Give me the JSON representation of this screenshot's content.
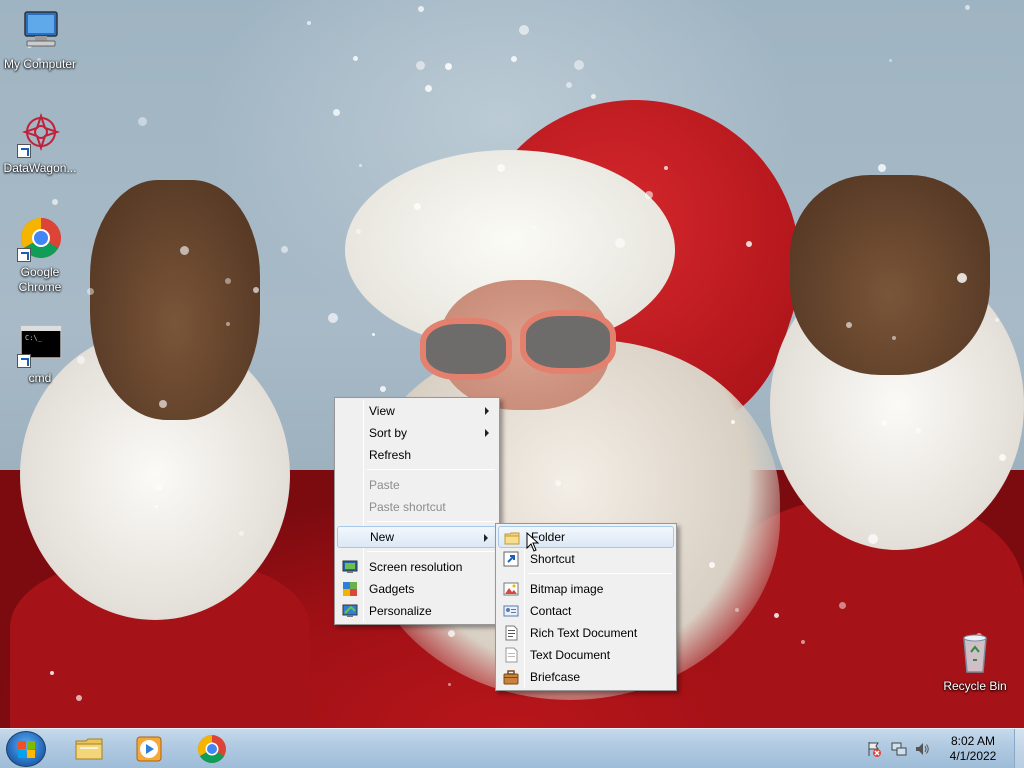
{
  "desktop_icons": [
    {
      "label": "My Computer",
      "icon": "computer-icon"
    },
    {
      "label": "DataWagon...",
      "icon": "datawagon-icon"
    },
    {
      "label": "Google Chrome",
      "icon": "chrome-icon"
    },
    {
      "label": "cmd",
      "icon": "cmd-icon"
    },
    {
      "label": "Recycle Bin",
      "icon": "recycle-bin-icon"
    }
  ],
  "context_menu": {
    "items": [
      {
        "label": "View",
        "submenu": true
      },
      {
        "label": "Sort by",
        "submenu": true
      },
      {
        "label": "Refresh"
      },
      {
        "label": "Paste",
        "disabled": true
      },
      {
        "label": "Paste shortcut",
        "disabled": true
      },
      {
        "label": "New",
        "submenu": true
      },
      {
        "label": "Screen resolution",
        "icon": "screen-resolution-icon"
      },
      {
        "label": "Gadgets",
        "icon": "gadgets-icon"
      },
      {
        "label": "Personalize",
        "icon": "personalize-icon"
      }
    ]
  },
  "new_submenu": {
    "items": [
      {
        "label": "Folder",
        "icon": "folder-icon"
      },
      {
        "label": "Shortcut",
        "icon": "shortcut-icon"
      },
      {
        "label": "Bitmap image",
        "icon": "bitmap-icon"
      },
      {
        "label": "Contact",
        "icon": "contact-icon"
      },
      {
        "label": "Rich Text Document",
        "icon": "rich-text-icon"
      },
      {
        "label": "Text Document",
        "icon": "text-document-icon"
      },
      {
        "label": "Briefcase",
        "icon": "briefcase-icon"
      }
    ]
  },
  "taskbar": {
    "pinned": [
      "file-explorer-icon",
      "media-player-icon",
      "chrome-icon"
    ],
    "tray_icons": [
      "action-center-icon",
      "network-icon",
      "volume-icon"
    ],
    "time": "8:02 AM",
    "date": "4/1/2022"
  }
}
